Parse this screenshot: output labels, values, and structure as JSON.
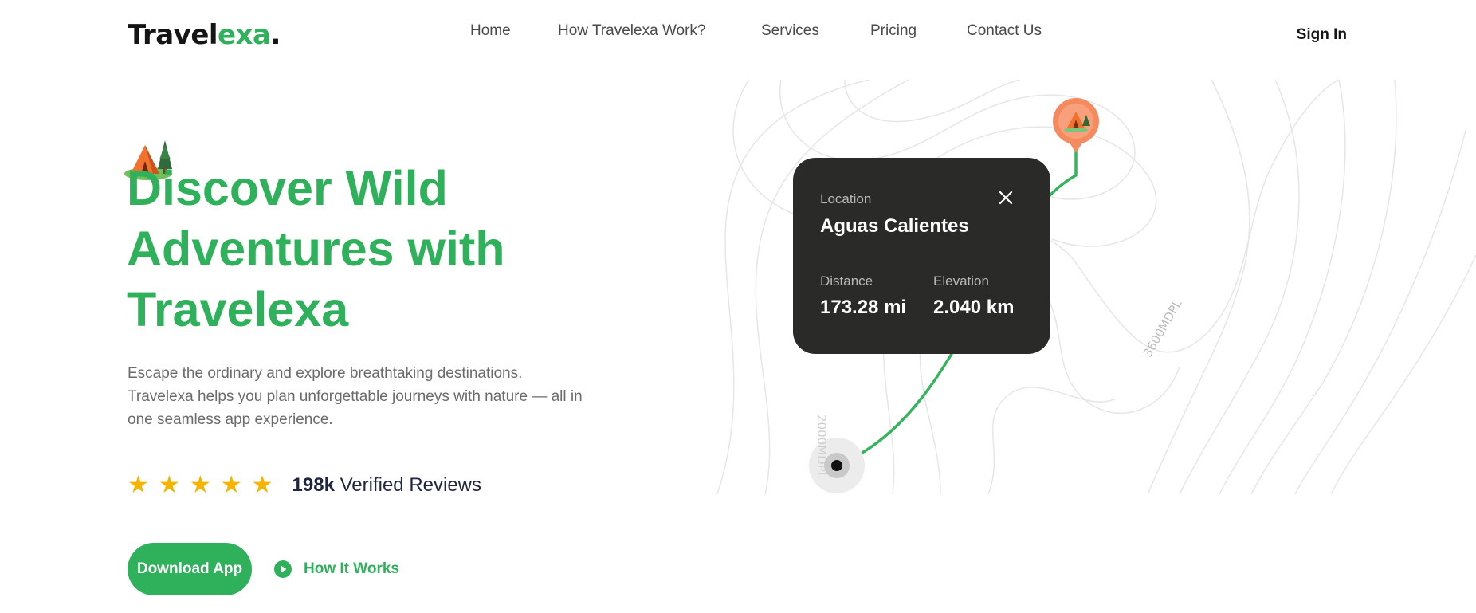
{
  "header": {
    "logo": {
      "part1": "Travel",
      "part2": "exa",
      "dot": "."
    },
    "nav": [
      "Home",
      "How Travelexa Work?",
      "Services",
      "Pricing",
      "Contact Us"
    ],
    "signin_label": "Sign In"
  },
  "hero": {
    "title_lines": [
      "Discover Wild",
      "Adventures with",
      "Travelexa"
    ],
    "description_lines": [
      "Escape the ordinary and explore breathtaking destinations.",
      "Travelexa helps you plan unforgettable journeys with nature — all in",
      "one seamless app experience."
    ],
    "rating": {
      "stars": 5,
      "count": "198k",
      "label": "Verified Reviews"
    },
    "download_label": "Download App",
    "how_label": "How It Works",
    "icons": {
      "camp": "tent-icon",
      "star": "star-icon",
      "play": "play-icon"
    }
  },
  "map": {
    "contour_label_1": "2000MDPL",
    "contour_label_2": "3600MDPL",
    "card": {
      "location_label": "Location",
      "location_value": "Aguas Calientes",
      "distance_label": "Distance",
      "distance_value": "173.28 mi",
      "elevation_label": "Elevation",
      "elevation_value": "2.040 km"
    }
  },
  "colors": {
    "accent": "#2fb05a",
    "card_bg": "#2a2b28",
    "pin": "#f58a5f",
    "star": "#f5b400"
  }
}
